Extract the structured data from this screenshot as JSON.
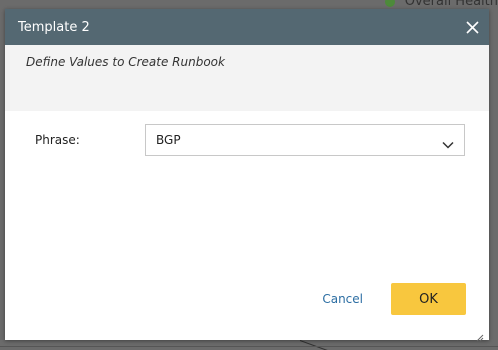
{
  "background": {
    "status_label": "Overall Health"
  },
  "dialog": {
    "title": "Template 2",
    "subtitle": "Define Values to Create Runbook",
    "fields": [
      {
        "label": "Phrase:",
        "value": "BGP"
      }
    ],
    "buttons": {
      "cancel_label": "Cancel",
      "ok_label": "OK"
    }
  },
  "colors": {
    "titlebar": "#546872",
    "ok_button": "#f8c73e",
    "cancel_link": "#2c6ea3",
    "subheader_bg": "#f3f3f3"
  },
  "icons": {
    "close": "close-icon",
    "dropdown": "chevron-down-icon",
    "status": "status-dot-icon",
    "resize": "resize-grip-icon"
  }
}
